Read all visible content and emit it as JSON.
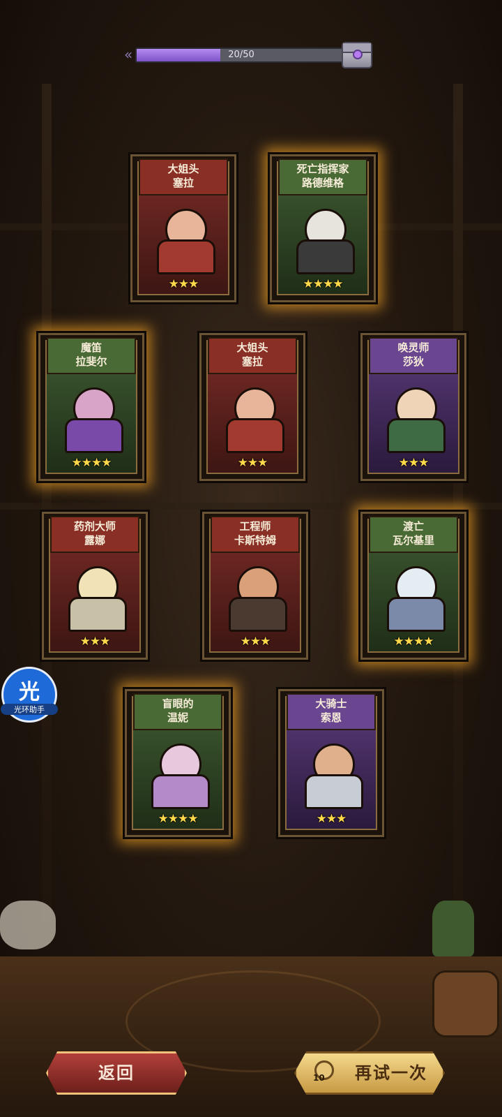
{
  "progress": {
    "text": "20/50",
    "fraction": 0.4
  },
  "cards": [
    {
      "title_line1": "大姐头",
      "title_line2": "塞拉",
      "stars": "★★★",
      "star_count": 3,
      "frame": "red",
      "glow": false
    },
    {
      "title_line1": "死亡指挥家",
      "title_line2": "路德维格",
      "stars": "★★★★",
      "star_count": 4,
      "frame": "green",
      "glow": true
    },
    {
      "title_line1": "魔笛",
      "title_line2": "拉斐尔",
      "stars": "★★★★",
      "star_count": 4,
      "frame": "green",
      "glow": true
    },
    {
      "title_line1": "大姐头",
      "title_line2": "塞拉",
      "stars": "★★★",
      "star_count": 3,
      "frame": "red",
      "glow": false
    },
    {
      "title_line1": "唤灵师",
      "title_line2": "莎狄",
      "stars": "★★★",
      "star_count": 3,
      "frame": "purple",
      "glow": false
    },
    {
      "title_line1": "药剂大师",
      "title_line2": "露娜",
      "stars": "★★★",
      "star_count": 3,
      "frame": "red",
      "glow": false
    },
    {
      "title_line1": "工程师",
      "title_line2": "卡斯特姆",
      "stars": "★★★",
      "star_count": 3,
      "frame": "red",
      "glow": false
    },
    {
      "title_line1": "渡亡",
      "title_line2": "瓦尔基里",
      "stars": "★★★★",
      "star_count": 4,
      "frame": "green",
      "glow": true
    },
    {
      "title_line1": "盲眼的",
      "title_line2": "温妮",
      "stars": "★★★★",
      "star_count": 4,
      "frame": "green",
      "glow": true
    },
    {
      "title_line1": "大骑士",
      "title_line2": "索恩",
      "stars": "★★★",
      "star_count": 3,
      "frame": "purple",
      "glow": false
    }
  ],
  "assistant": {
    "glyph": "光",
    "label": "光环助手"
  },
  "buttons": {
    "back_label": "返回",
    "retry_label": "再试一次",
    "retry_cost": "10"
  },
  "colors": {
    "star": "#ffd94a",
    "glow": "#ffaa28",
    "progress_fill": "#9a6fe0",
    "assistant": "#1e6ad8"
  }
}
